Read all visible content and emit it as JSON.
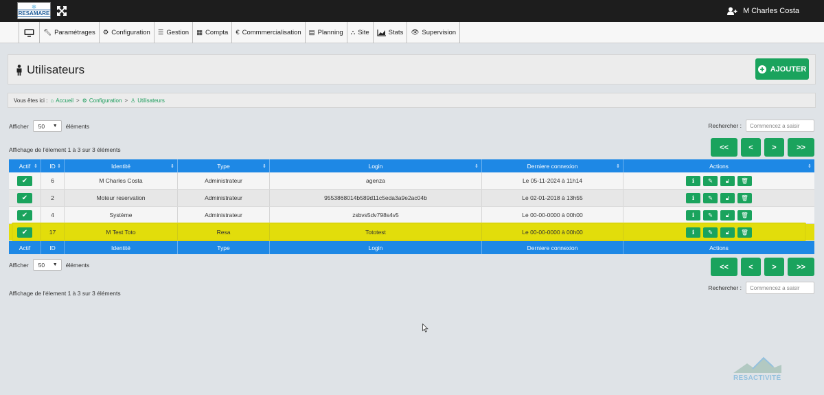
{
  "header": {
    "logo_text": "RESAMARE",
    "user_name": "M Charles Costa"
  },
  "menu": [
    {
      "label": "Paramétrages",
      "icon": "wrench-icon"
    },
    {
      "label": "Configuration",
      "icon": "cogs-icon"
    },
    {
      "label": "Gestion",
      "icon": "list-icon"
    },
    {
      "label": "Compta",
      "icon": "calculator-icon"
    },
    {
      "label": "Commmercialisation",
      "icon": "euro-icon"
    },
    {
      "label": "Planning",
      "icon": "calendar-icon"
    },
    {
      "label": "Site",
      "icon": "sitemap-icon"
    },
    {
      "label": "Stats",
      "icon": "area-chart-icon"
    },
    {
      "label": "Supervision",
      "icon": "eye-icon"
    }
  ],
  "page": {
    "title": "Utilisateurs",
    "add_button": "AJOUTER"
  },
  "breadcrumb": {
    "prefix": "Vous êtes ici :",
    "items": [
      "Accueil",
      "Configuration",
      "Utilisateurs"
    ],
    "separator": ">"
  },
  "controls": {
    "show_prefix": "Afficher",
    "page_size": "50",
    "show_suffix": "éléments",
    "search_label": "Rechercher :",
    "search_placeholder": "Commencez a saisir",
    "info_text": "Affichage de l'élement 1 à 3 sur 3 éléments",
    "pager": {
      "first": "<<",
      "prev": "<",
      "next": ">",
      "last": ">>"
    }
  },
  "table": {
    "columns": [
      "Actif",
      "ID",
      "Identité",
      "Type",
      "Login",
      "Derniere connexion",
      "Actions"
    ],
    "rows": [
      {
        "id": "6",
        "identite": "M Charles Costa",
        "type": "Administrateur",
        "login": "agenza",
        "connexion": "Le 05-11-2024 à 11h14"
      },
      {
        "id": "2",
        "identite": "Moteur reservation",
        "type": "Administrateur",
        "login": "9553868014b589d11c5eda3a9e2ac04b",
        "connexion": "Le 02-01-2018 à 13h55"
      },
      {
        "id": "4",
        "identite": "Système",
        "type": "Administrateur",
        "login": "zsbvs5dv798s4v5",
        "connexion": "Le 00-00-0000 à 00h00"
      },
      {
        "id": "17",
        "identite": "M Test Toto",
        "type": "Resa",
        "login": "Tototest",
        "connexion": "Le 00-00-0000 à 00h00"
      }
    ]
  },
  "watermark": "RESACTIVITÉ",
  "colors": {
    "accent_green": "#1aa35d",
    "table_header_blue": "#1e88e5",
    "highlight_yellow": "#e2dd0b",
    "topbar": "#1d1d1d"
  }
}
